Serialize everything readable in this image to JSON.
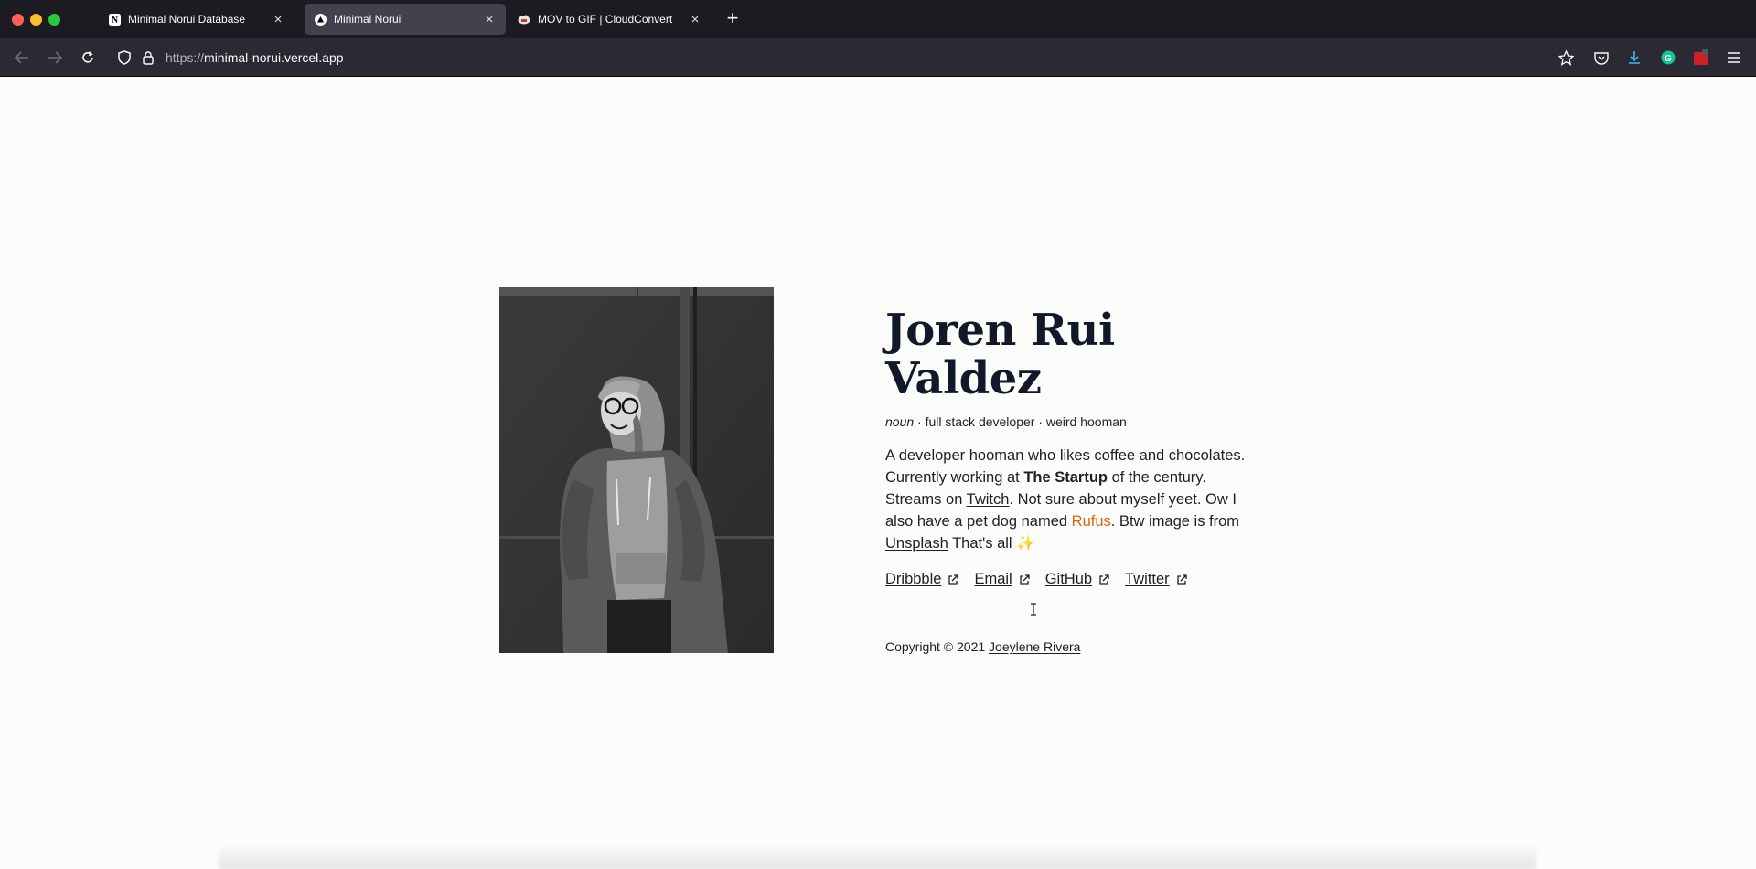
{
  "browser": {
    "tabs": [
      {
        "title": "Minimal Norui Database",
        "favicon": "notion-icon",
        "active": false
      },
      {
        "title": "Minimal Norui",
        "favicon": "vercel-icon",
        "active": true
      },
      {
        "title": "MOV to GIF | CloudConvert",
        "favicon": "cloud-icon",
        "active": false
      }
    ],
    "url_scheme": "https://",
    "url_host": "minimal-norui.vercel.app"
  },
  "profile": {
    "name_line1": "Joren Rui",
    "name_line2": "Valdez",
    "subtitle_noun": "noun",
    "subtitle_rest": " · full stack developer · weird hooman",
    "bio": {
      "p1": "A ",
      "strike": "developer",
      "p2": " hooman who likes coffee and chocolates. Currently working at ",
      "bold": "The Startup",
      "p3": " of the century. Streams on ",
      "twitch": "Twitch",
      "p4": ". Not sure about myself yeet. Ow I also have a pet dog named ",
      "rufus": "Rufus",
      "p5": ". Btw image is from ",
      "unsplash": "Unsplash",
      "p6": " That's all ",
      "emoji": "✨"
    },
    "links": [
      "Dribbble",
      "Email",
      "GitHub",
      "Twitter"
    ],
    "footer_prefix": "Copyright © 2021 ",
    "footer_author": "Joeylene Rivera"
  },
  "colors": {
    "accent_orange": "#d9650f",
    "heading": "#111827"
  }
}
